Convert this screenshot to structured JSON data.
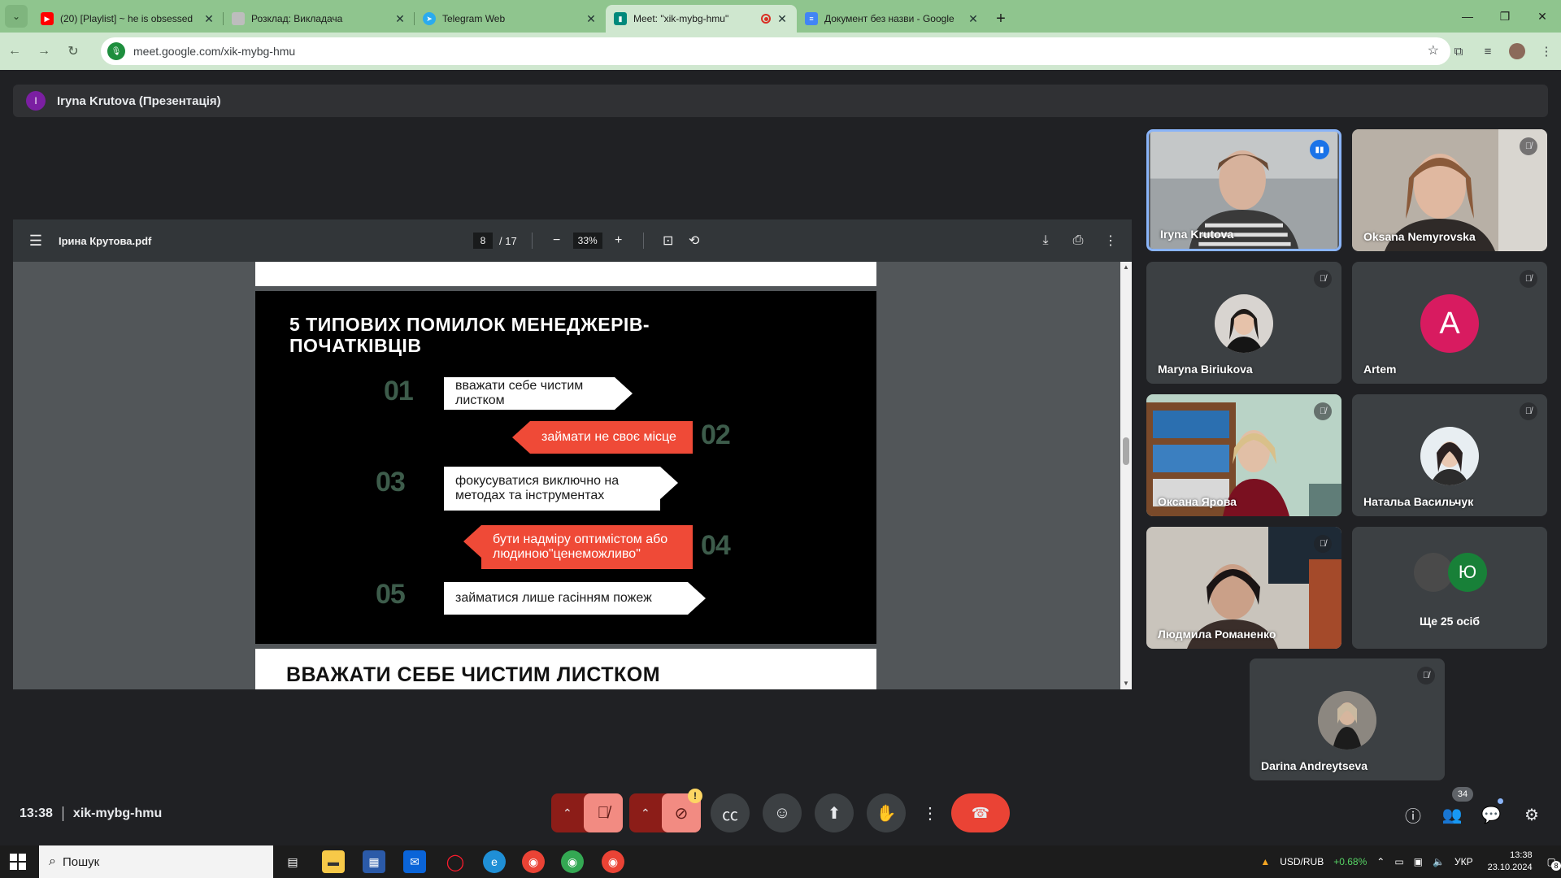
{
  "browser": {
    "tabs": [
      {
        "title": "(20) [Playlist] ~ he is obsessed",
        "favicon": "youtube-icon",
        "color": "#ff0000"
      },
      {
        "title": "Розклад: Викладача",
        "favicon": "page-icon",
        "color": "#9e9e9e"
      },
      {
        "title": "Telegram Web",
        "favicon": "telegram-icon",
        "color": "#2aabee"
      },
      {
        "title": "Meet: \"xik-mybg-hmu\"",
        "favicon": "meet-icon",
        "color": "#00897b",
        "active": true,
        "recording": true
      },
      {
        "title": "Документ без назви - Google",
        "favicon": "docs-icon",
        "color": "#4285f4"
      }
    ],
    "url": "meet.google.com/xik-mybg-hmu"
  },
  "meet": {
    "presenter_initial": "I",
    "presenter_label": "Iryna Krutova (Презентація)",
    "time": "13:38",
    "code": "xik-mybg-hmu",
    "participant_count": "34"
  },
  "pdf": {
    "filename": "Ірина Крутова.pdf",
    "page": "8",
    "page_total": "/ 17",
    "zoom": "33%",
    "slide": {
      "title_line1": "5 ТИПОВИХ ПОМИЛОК МЕНЕДЖЕРІВ-",
      "title_line2": "ПОЧАТКІВЦІВ",
      "items": [
        {
          "num": "01",
          "line1": "вважати себе чистим листком",
          "line2": ""
        },
        {
          "num": "02",
          "line1": "займати не своє місце",
          "line2": ""
        },
        {
          "num": "03",
          "line1": "фокусуватися виключно на",
          "line2": "методах та інструментах"
        },
        {
          "num": "04",
          "line1": "бути надміру оптимістом або",
          "line2": "людиною\"ценеможливо\""
        },
        {
          "num": "05",
          "line1": "займатися лише гасінням пожеж",
          "line2": ""
        }
      ]
    },
    "next_page_title": "ВВАЖАТИ СЕБЕ ЧИСТИМ ЛИСТКОМ"
  },
  "participants": [
    {
      "name": "Iryna Krutova",
      "type": "video",
      "speaking": true
    },
    {
      "name": "Oksana Nemyrovska",
      "type": "video",
      "muted": true
    },
    {
      "name": "Maryna Biriukova",
      "type": "photo",
      "muted": true
    },
    {
      "name": "Artem",
      "type": "letter",
      "letter": "A",
      "muted": true
    },
    {
      "name": "Оксана Ярова",
      "type": "video",
      "muted": true
    },
    {
      "name": "Натальа Васильчук",
      "type": "photo",
      "muted": true
    },
    {
      "name": "Людмила Романенко",
      "type": "video",
      "muted": true
    },
    {
      "name": "Ще 25 осіб",
      "type": "more",
      "letter": "Ю"
    },
    {
      "name": "Darina Andreytseva",
      "type": "photo",
      "muted": true
    }
  ],
  "taskbar": {
    "search_placeholder": "Пошук",
    "ticker": "USD/RUB",
    "ticker_change": "+0.68%",
    "lang": "УКР",
    "time": "13:38",
    "date": "23.10.2024",
    "notif_count": "8"
  },
  "colors": {
    "accent_red": "#ef4a37",
    "slide_number": "#3d5c4b",
    "end_call": "#ea4335",
    "speaker_border": "#8ab4f8"
  }
}
